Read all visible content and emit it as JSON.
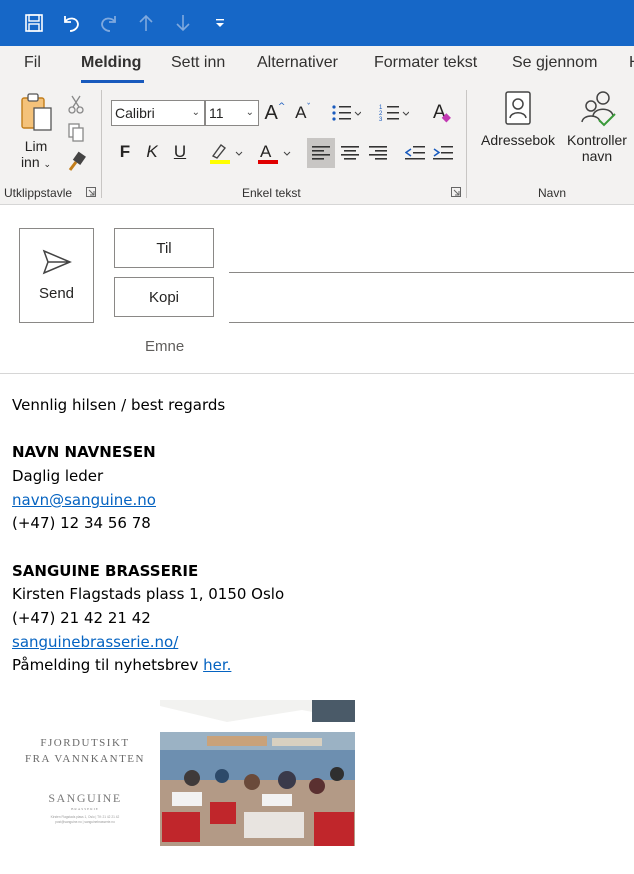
{
  "tabs": [
    {
      "label": "Fil"
    },
    {
      "label": "Melding"
    },
    {
      "label": "Sett inn"
    },
    {
      "label": "Alternativer"
    },
    {
      "label": "Formater tekst"
    },
    {
      "label": "Se gjennom"
    },
    {
      "label": "H"
    }
  ],
  "ribbon": {
    "paste_label_1": "Lim",
    "paste_label_2": "inn",
    "clipboard_group": "Utklippstavle",
    "font_name": "Calibri",
    "font_size": "11",
    "font_group": "Enkel tekst",
    "bold": "F",
    "italic": "K",
    "underline": "U",
    "addressbook_label": "Adressebok",
    "checknames_label_1": "Kontroller",
    "checknames_label_2": "navn",
    "names_group": "Navn",
    "highlight_color": "#ffff00",
    "font_color": "#e00000"
  },
  "compose": {
    "send_label": "Send",
    "to_label": "Til",
    "cc_label": "Kopi",
    "subject_label": "Emne",
    "to_value": "",
    "cc_value": "",
    "subject_value": ""
  },
  "body": {
    "greeting": "Vennlig hilsen / best regards",
    "name": "NAVN NAVNESEN",
    "role": "Daglig leder",
    "email": "navn@sanguine.no",
    "phone": "(+47) 12 34 56 78",
    "company": "SANGUINE BRASSERIE",
    "address": "Kirsten Flagstads plass 1, 0150 Oslo",
    "company_phone": "(+47) 21 42 21 42",
    "website": "sanguinebrasserie.no/",
    "newsletter_text": "Påmelding til nyhetsbrev ",
    "newsletter_link": "her."
  },
  "promo": {
    "headline_1": "FJORDUTSIKT",
    "headline_2": "FRA VANNKANTEN",
    "brand": "SANGUINE",
    "brand_sub": "BRASSERIE",
    "small_line_1": "Kirsten Flagstads plass 1, Oslo | Tlf: 21 42 21 42",
    "small_line_2": "post@sanguine.no | sanguinebrasserie.no"
  }
}
